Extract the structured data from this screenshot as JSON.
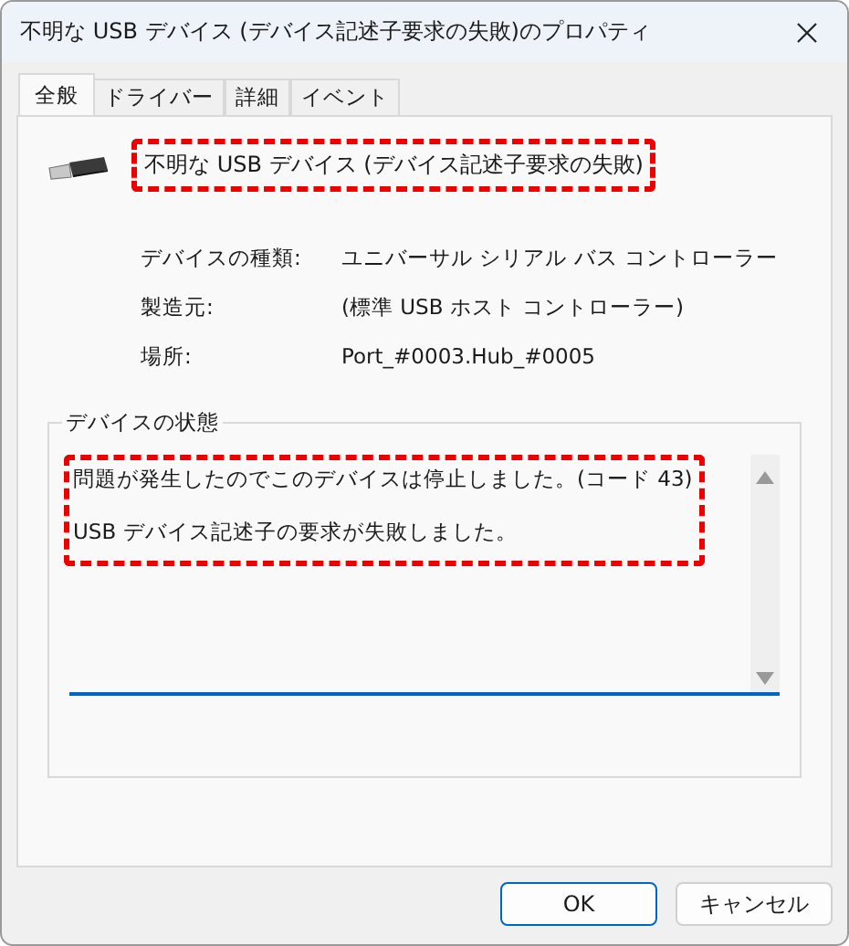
{
  "window": {
    "title": "不明な USB デバイス (デバイス記述子要求の失敗)のプロパティ"
  },
  "tabs": [
    {
      "label": "全般",
      "selected": true
    },
    {
      "label": "ドライバー",
      "selected": false
    },
    {
      "label": "詳細",
      "selected": false
    },
    {
      "label": "イベント",
      "selected": false
    }
  ],
  "device": {
    "name": "不明な USB デバイス (デバイス記述子要求の失敗)",
    "highlighted": true
  },
  "properties": [
    {
      "label": "デバイスの種類:",
      "value": "ユニバーサル シリアル バス コントローラー"
    },
    {
      "label": "製造元:",
      "value": "(標準 USB ホスト コントローラー)"
    },
    {
      "label": "場所:",
      "value": "Port_#0003.Hub_#0005"
    }
  ],
  "status": {
    "title": "デバイスの状態",
    "highlighted": true,
    "lines": [
      "問題が発生したのでこのデバイスは停止しました。(コード 43)",
      "USB デバイス記述子の要求が失敗しました。"
    ]
  },
  "buttons": [
    {
      "label": "OK",
      "default": true
    },
    {
      "label": "キャンセル",
      "default": false
    }
  ]
}
